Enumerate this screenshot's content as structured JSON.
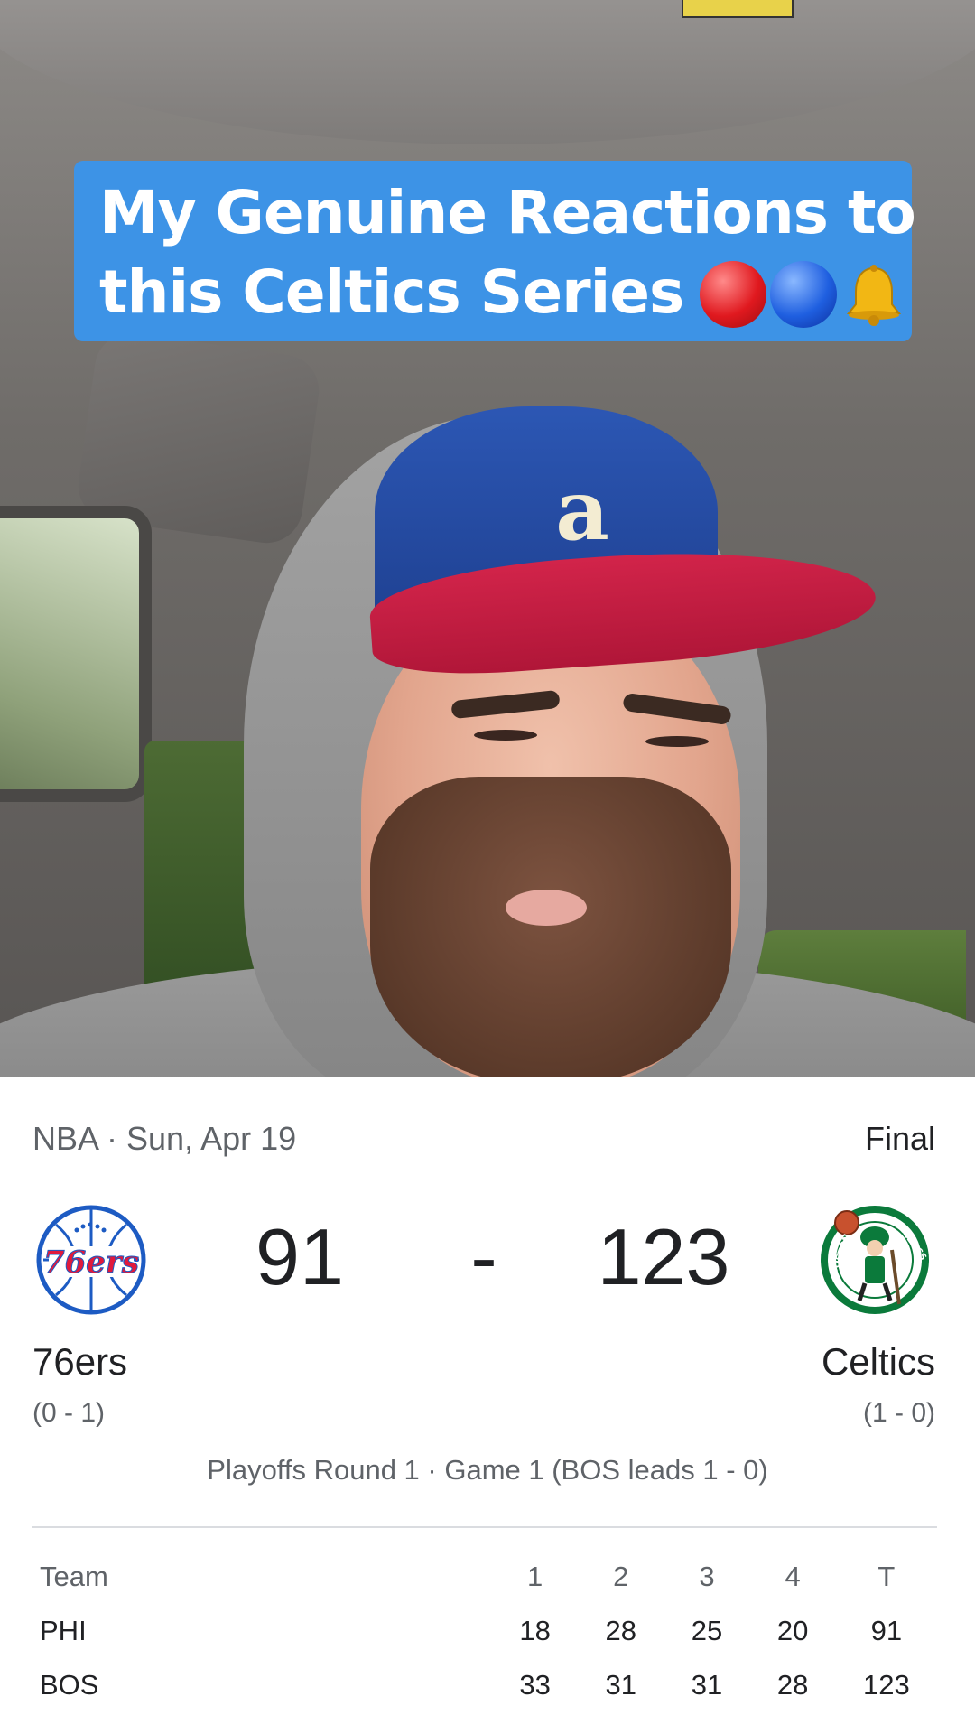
{
  "overlay": {
    "title_line1": "My Genuine Reactions to",
    "title_line2": "this Celtics Series",
    "emojis": [
      "red-circle",
      "blue-circle",
      "bell"
    ]
  },
  "game": {
    "league_date": "NBA · Sun, Apr 19",
    "status": "Final",
    "home": {
      "name": "76ers",
      "record": "(0 - 1)",
      "score": "91",
      "abbr": "PHI"
    },
    "away": {
      "name": "Celtics",
      "record": "(1 - 0)",
      "score": "123",
      "abbr": "BOS"
    },
    "separator": "-",
    "series": "Playoffs Round 1 · Game 1 (BOS leads 1 - 0)"
  },
  "linescore": {
    "headers": [
      "Team",
      "1",
      "2",
      "3",
      "4",
      "T"
    ],
    "rows": [
      [
        "PHI",
        "18",
        "28",
        "25",
        "20",
        "91"
      ],
      [
        "BOS",
        "33",
        "31",
        "31",
        "28",
        "123"
      ]
    ]
  },
  "colors": {
    "banner": "#3d93e6",
    "sixers_blue": "#1d5bc3",
    "sixers_red": "#e01a3c",
    "celtics_green": "#0b7a3b"
  }
}
